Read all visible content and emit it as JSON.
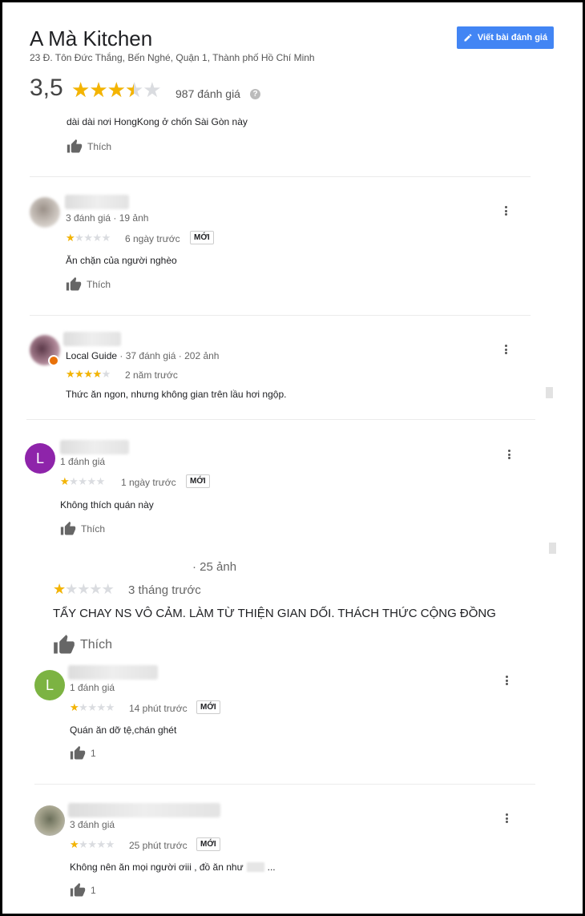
{
  "header": {
    "title": "A Mà Kitchen",
    "address": "23 Đ. Tôn Đức Thắng, Bến Nghé, Quận 1, Thành phố Hồ Chí Minh",
    "write_review_label": "Viết bài đánh giá",
    "rating_value": "3,5",
    "rating_stars": 3.5,
    "review_count": "987 đánh giá",
    "info_symbol": "?"
  },
  "like_label": "Thích",
  "new_badge": "MỚI",
  "reviews": [
    {
      "text": "dài dài nơi HongKong ở chốn Sài Gòn này"
    },
    {
      "meta": "3 đánh giá · 19 ảnh",
      "stars": 1,
      "time": "6 ngày trước",
      "text": "Ăn chặn của người nghèo"
    },
    {
      "guide": "Local Guide",
      "meta": " · 37 đánh giá · 202 ảnh",
      "stars": 4,
      "time": "2 năm trước",
      "text": "Thức ăn ngon, nhưng không gian trên lầu hơi ngộp."
    },
    {
      "avatar_letter": "L",
      "meta": "1 đánh giá",
      "stars": 1,
      "time": "1 ngày trước",
      "text": "Không thích quán này"
    },
    {
      "meta": "· 25 ảnh",
      "stars": 1,
      "time": "3 tháng trước",
      "text": "TẨY CHAY NS VÔ CẢM. LÀM TỪ THIỆN GIAN DỐI. THÁCH THỨC CỘNG ĐỒNG"
    },
    {
      "avatar_letter": "L",
      "meta": "1 đánh giá",
      "stars": 1,
      "time": "14 phút trước",
      "text": "Quán ăn dỡ tệ,chán ghét",
      "likes": "1"
    },
    {
      "meta": "3 đánh giá",
      "stars": 1,
      "time": "25 phút trước",
      "text": "Không nên ăn mọi người ơiii , đồ ăn như",
      "text_suffix": "...",
      "likes": "1"
    }
  ],
  "colors": {
    "accent": "#4285f4",
    "star": "#f4b400",
    "star_empty": "#dadce0",
    "avatar_purple": "#8e24aa",
    "avatar_green": "#7cb342"
  },
  "icons": {
    "write": "pencil-icon",
    "like": "thumbs-up-icon",
    "more": "more-vert-icon",
    "info": "help-circle-icon"
  }
}
